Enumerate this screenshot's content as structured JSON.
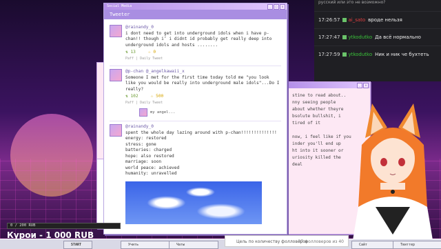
{
  "colors": {
    "accent": "#a98ee2",
    "pink_window": "#fde8f4",
    "chat_bg": "#1f1f23"
  },
  "tweeter": {
    "window_title": "Social Media",
    "app_title": "Tweeter",
    "tweets": [
      {
        "handle": "@rainandy_0",
        "text": "i dont need to get into underground idols when i have p-chan!! though i’ i didnt id probably get really deep into underground idols and hosts ........",
        "retweets": "13",
        "likes": "0",
        "meta": "Paff | Daily Tweet"
      },
      {
        "handle": "@p-chan @_angelkawaii_x",
        "text": "Someone I met for the first time today told me \"you look like you would be really into underground male idols\"...Do I really?",
        "retweets": "102",
        "likes": "500",
        "meta": "Paff | Daily Tweet",
        "reply": "my angel..."
      },
      {
        "handle": "@rainandy_0",
        "text_lines": [
          "spent the whole day lazing around with p-chan!!!!!!!!!!!!!!",
          "energy: restored",
          "stress: gone",
          "batteries: charged",
          "hope: also restored",
          "marriage: soon",
          "world peace: achieved",
          "humanity: unravelled"
        ]
      }
    ]
  },
  "pink_window": {
    "lines": [
      "stine to read about..",
      "nny seeing people",
      "about whether theyre",
      "bsolute bullshit, i",
      "tired of it",
      "",
      "now, i feel like if you",
      "inder you'll end up",
      "ht into it sooner or",
      "uriosity killed the",
      "deal"
    ]
  },
  "chat": {
    "top_text": "русский или это не возможно?",
    "messages": [
      {
        "time": "17:26:57",
        "user": "ai_sato",
        "color": "#e04040",
        "text": "вроде нельзя"
      },
      {
        "time": "17:27:47",
        "user": "ytkodutko",
        "color": "#3ac33a",
        "text": "Да всё нормально"
      },
      {
        "time": "17:27:59",
        "user": "ytkodutko",
        "color": "#3ac33a",
        "text": "Ник и ник че бухтеть"
      }
    ]
  },
  "donation": {
    "progress_text": "0 / 200 RUB",
    "title": "Курои - 1 000 RUB",
    "progress": 0
  },
  "taskbar": {
    "start": "START",
    "items": [
      "Учить",
      "Чаты",
      "Сайт",
      "Твиттер"
    ]
  },
  "goal": {
    "label": "Цель по количеству фолловеров",
    "count": "37 фолловеров из 40"
  }
}
